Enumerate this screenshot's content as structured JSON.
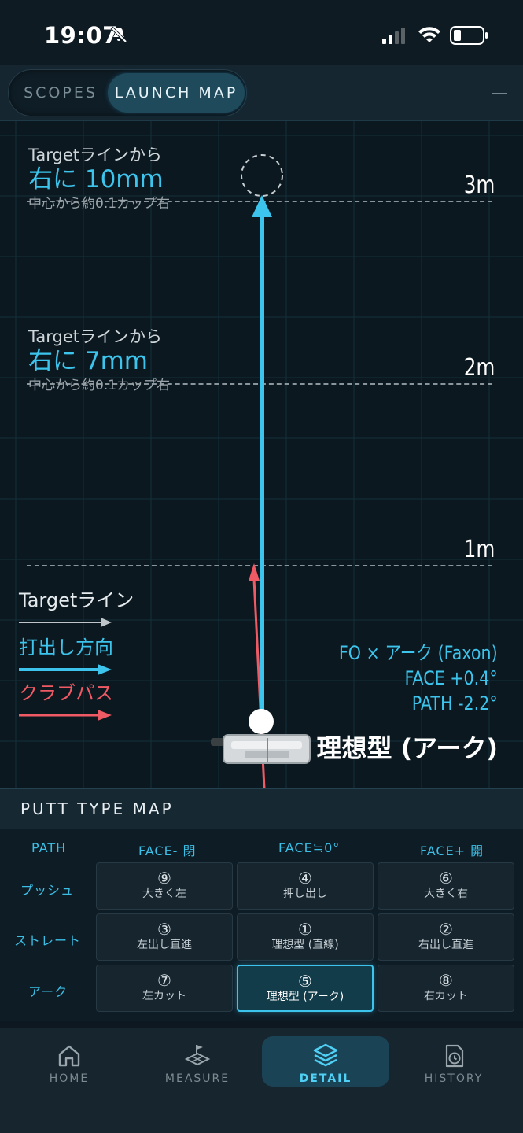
{
  "status_bar": {
    "time": "19:07"
  },
  "top_tabs": [
    {
      "label": "SCOPES",
      "active": false
    },
    {
      "label": "LAUNCH MAP",
      "active": true
    }
  ],
  "map": {
    "distance_markers": [
      {
        "label": "3m"
      },
      {
        "label": "2m"
      },
      {
        "label": "1m"
      }
    ],
    "results": [
      {
        "prefix": "Targetラインから",
        "value": "右に 10mm",
        "detail": "中心から約0.1カップ右"
      },
      {
        "prefix": "Targetラインから",
        "value": "右に 7mm",
        "detail": "中心から約0.1カップ右"
      }
    ],
    "legend": [
      {
        "label": "Targetライン",
        "color": "#bfc5c8"
      },
      {
        "label": "打出し方向",
        "color": "#3cc4ec"
      },
      {
        "label": "クラブパス",
        "color": "#f05a64"
      }
    ],
    "params": {
      "type": "FO × アーク (Faxon)",
      "face": "FACE +0.4°",
      "path": "PATH -2.2°"
    },
    "putt_type_label": "理想型 (アーク)"
  },
  "putt_type_map": {
    "title": "PUTT TYPE MAP",
    "corner_header": "PATH",
    "col_headers": [
      "FACE- 閉",
      "FACE≒0°",
      "FACE+ 開"
    ],
    "rows": [
      {
        "label": "プッシュ",
        "cells": [
          {
            "num": "⑨",
            "name": "大きく左"
          },
          {
            "num": "④",
            "name": "押し出し"
          },
          {
            "num": "⑥",
            "name": "大きく右"
          }
        ]
      },
      {
        "label": "ストレート",
        "cells": [
          {
            "num": "③",
            "name": "左出し直進"
          },
          {
            "num": "①",
            "name": "理想型 (直線)"
          },
          {
            "num": "②",
            "name": "右出し直進"
          }
        ]
      },
      {
        "label": "アーク",
        "cells": [
          {
            "num": "⑦",
            "name": "左カット"
          },
          {
            "num": "⑤",
            "name": "理想型 (アーク)",
            "active": true
          },
          {
            "num": "⑧",
            "name": "右カット"
          }
        ]
      }
    ]
  },
  "bottom_nav": [
    {
      "label": "HOME",
      "icon": "home-icon"
    },
    {
      "label": "MEASURE",
      "icon": "measure-icon"
    },
    {
      "label": "DETAIL",
      "icon": "layers-icon",
      "active": true
    },
    {
      "label": "HISTORY",
      "icon": "history-icon"
    }
  ],
  "colors": {
    "accent": "#3cc4ec",
    "club_path": "#f05a64",
    "background": "#0c1820"
  }
}
